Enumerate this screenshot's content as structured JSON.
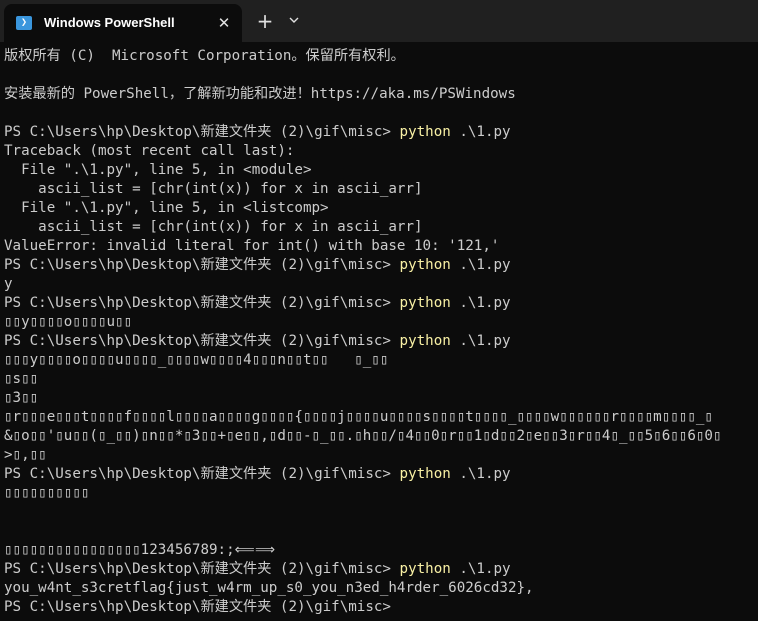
{
  "tab": {
    "title": "Windows PowerShell",
    "close": "✕",
    "new_tab": "+"
  },
  "icons": {
    "app": "powershell-icon",
    "close": "close-icon",
    "add": "plus-icon",
    "dropdown": "chevron-down-icon"
  },
  "console": {
    "lines": [
      {
        "text": "版权所有 (C)  Microsoft Corporation。保留所有权利。"
      },
      {
        "text": ""
      },
      {
        "text": "安装最新的 PowerShell，了解新功能和改进！https://aka.ms/PSWindows"
      },
      {
        "text": ""
      },
      {
        "prompt": "PS C:\\Users\\hp\\Desktop\\新建文件夹 (2)\\gif\\misc> ",
        "cmd": "python",
        "args": " .\\1.py"
      },
      {
        "text": "Traceback (most recent call last):"
      },
      {
        "text": "  File \".\\1.py\", line 5, in <module>"
      },
      {
        "text": "    ascii_list = [chr(int(x)) for x in ascii_arr]"
      },
      {
        "text": "  File \".\\1.py\", line 5, in <listcomp>"
      },
      {
        "text": "    ascii_list = [chr(int(x)) for x in ascii_arr]"
      },
      {
        "text": "ValueError: invalid literal for int() with base 10: '121,'"
      },
      {
        "prompt": "PS C:\\Users\\hp\\Desktop\\新建文件夹 (2)\\gif\\misc> ",
        "cmd": "python",
        "args": " .\\1.py"
      },
      {
        "text": "y"
      },
      {
        "prompt": "PS C:\\Users\\hp\\Desktop\\新建文件夹 (2)\\gif\\misc> ",
        "cmd": "python",
        "args": " .\\1.py"
      },
      {
        "text": "▯▯y▯▯▯▯o▯▯▯▯u▯▯"
      },
      {
        "prompt": "PS C:\\Users\\hp\\Desktop\\新建文件夹 (2)\\gif\\misc> ",
        "cmd": "python",
        "args": " .\\1.py"
      },
      {
        "text": "▯▯▯y▯▯▯▯o▯▯▯▯u▯▯▯▯_▯▯▯▯w▯▯▯▯4▯▯▯n▯▯t▯▯   ▯_▯▯"
      },
      {
        "text": "▯s▯▯"
      },
      {
        "text": "▯3▯▯"
      },
      {
        "text": "▯r▯▯▯e▯▯▯t▯▯▯▯f▯▯▯▯l▯▯▯▯a▯▯▯▯g▯▯▯▯{▯▯▯▯j▯▯▯▯u▯▯▯▯s▯▯▯▯t▯▯▯▯_▯▯▯▯w▯▯▯▯▯▯r▯▯▯▯m▯▯▯▯_▯"
      },
      {
        "text": "&▯o▯▯'▯u▯▯(▯_▯▯)▯n▯▯*▯3▯▯+▯e▯▯,▯d▯▯-▯_▯▯.▯h▯▯/▯4▯▯0▯r▯▯1▯d▯▯2▯e▯▯3▯r▯▯4▯_▯▯5▯6▯▯6▯0▯"
      },
      {
        "text": ">▯,▯▯"
      },
      {
        "prompt": "PS C:\\Users\\hp\\Desktop\\新建文件夹 (2)\\gif\\misc> ",
        "cmd": "python",
        "args": " .\\1.py"
      },
      {
        "text": "▯▯▯▯▯▯▯▯▯▯"
      },
      {
        "text": ""
      },
      {
        "text": ""
      },
      {
        "text": "▯▯▯▯▯▯▯▯▯▯▯▯▯▯▯▯123456789:;⟸⟹"
      },
      {
        "prompt": "PS C:\\Users\\hp\\Desktop\\新建文件夹 (2)\\gif\\misc> ",
        "cmd": "python",
        "args": " .\\1.py"
      },
      {
        "text": "you_w4nt_s3cretflag{just_w4rm_up_s0_you_n3ed_h4rder_6026cd32},"
      },
      {
        "prompt": "PS C:\\Users\\hp\\Desktop\\新建文件夹 (2)\\gif\\misc> ",
        "cmd": "",
        "args": ""
      }
    ]
  },
  "colors": {
    "background": "#0c0c0c",
    "text": "#cccccc",
    "command": "#f9f1a5",
    "titlebar": "#202020"
  }
}
